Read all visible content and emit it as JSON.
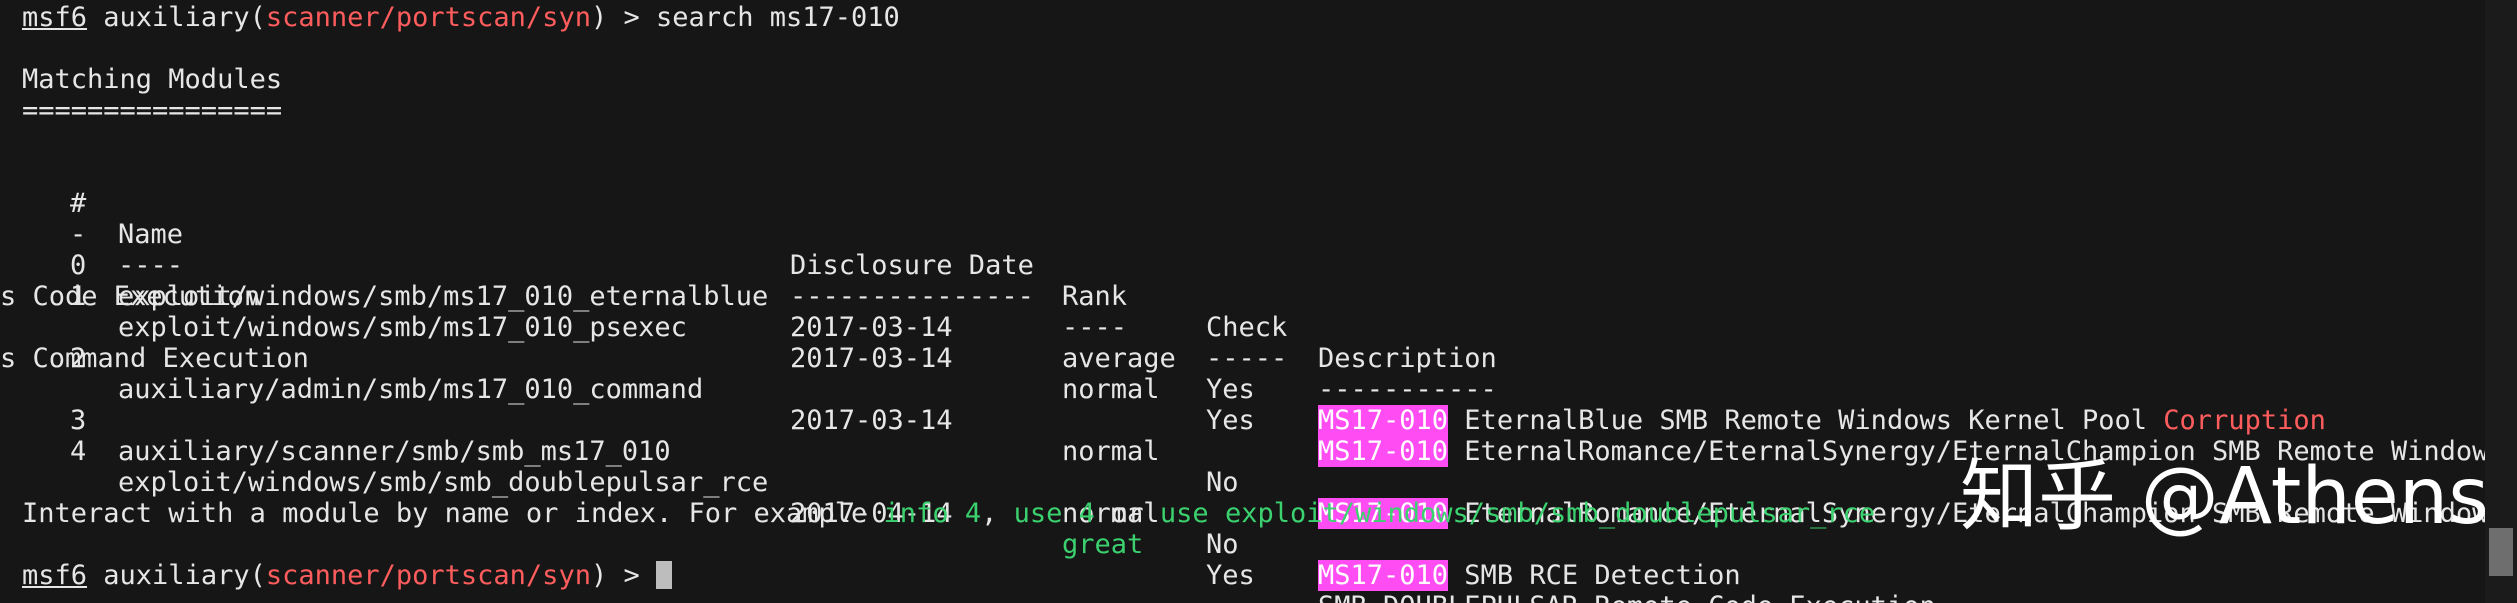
{
  "prompt": {
    "prefix": "msf6",
    "module_type": " auxiliary(",
    "module_path": "scanner/portscan/syn",
    "suffix": ") > ",
    "command": "search ms17-010"
  },
  "section": {
    "title": "Matching Modules",
    "underline": "================"
  },
  "table": {
    "headers": {
      "num": "#",
      "name": "Name",
      "date": "Disclosure Date",
      "rank": "Rank",
      "check": "Check",
      "desc": "Description"
    },
    "separators": {
      "num": "-",
      "name": "----",
      "date": "---------------",
      "rank": "----",
      "check": "-----",
      "desc": "-----------"
    },
    "rows": [
      {
        "num": "0",
        "name": "exploit/windows/smb/ms17_010_eternalblue",
        "date": "2017-03-14",
        "rank": "average",
        "check": "Yes",
        "highlight": "MS17-010",
        "desc": " EternalBlue SMB Remote Windows Kernel Pool ",
        "desc_red": "Corruption"
      },
      {
        "num": "1",
        "name": "exploit/windows/smb/ms17_010_psexec",
        "date": "2017-03-14",
        "rank": "normal",
        "check": "Yes",
        "highlight": "MS17-010",
        "desc": " EternalRomance/EternalSynergy/EternalChampion SMB Remote Window",
        "wrap": "s Code Execution"
      },
      {
        "num": "2",
        "name": "auxiliary/admin/smb/ms17_010_command",
        "date": "2017-03-14",
        "rank": "normal",
        "check": "No",
        "highlight": "MS17-010",
        "desc": " EternalRomance/EternalSynergy/EternalChampion SMB Remote Window",
        "wrap": "s Command Execution"
      },
      {
        "num": "3",
        "name": "auxiliary/scanner/smb/smb_ms17_010",
        "date": "",
        "rank": "normal",
        "check": "No",
        "highlight": "MS17-010",
        "desc": " SMB RCE Detection"
      },
      {
        "num": "4",
        "name": "exploit/windows/smb/smb_doublepulsar_rce",
        "date": "2017-04-14",
        "rank": "great",
        "check": "Yes",
        "desc": "SMB DOUBLEPULSAR Remote Code Execution"
      }
    ]
  },
  "hint": {
    "text1": "Interact with a module by name or index. For example ",
    "cmd1": "info 4",
    "sep1": ", ",
    "cmd2": "use 4",
    "sep2": " or ",
    "cmd3": "use exploit/windows/smb/smb_doublepulsar_rce"
  },
  "watermark": "知乎 @Athens",
  "colors": {
    "background": "#161616",
    "text": "#e6e6e6",
    "red": "#ff5d5d",
    "green": "#3bd16f",
    "highlight": "#ff4df3"
  }
}
